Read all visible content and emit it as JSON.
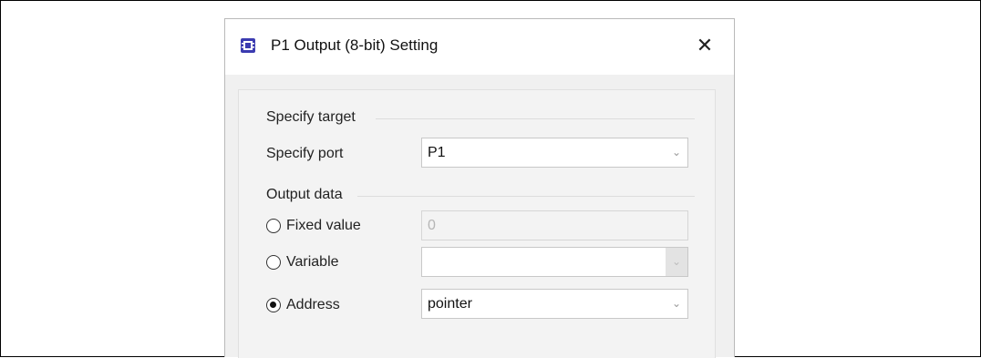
{
  "dialog": {
    "title": "P1 Output (8-bit) Setting",
    "close_glyph": "✕",
    "icon": "app-chip-icon"
  },
  "target": {
    "group_label": "Specify target",
    "port_label": "Specify port",
    "port_value": "P1"
  },
  "output": {
    "group_label": "Output data",
    "fixed": {
      "label": "Fixed value",
      "value": "0",
      "selected": false,
      "enabled": false
    },
    "variable": {
      "label": "Variable",
      "value": "",
      "selected": false,
      "enabled": false
    },
    "address": {
      "label": "Address",
      "value": "pointer",
      "selected": true,
      "enabled": true
    }
  },
  "colors": {
    "dialog_bg": "#f0f0f0",
    "title_bg": "#ffffff",
    "icon_accent": "#3b3bb0"
  }
}
